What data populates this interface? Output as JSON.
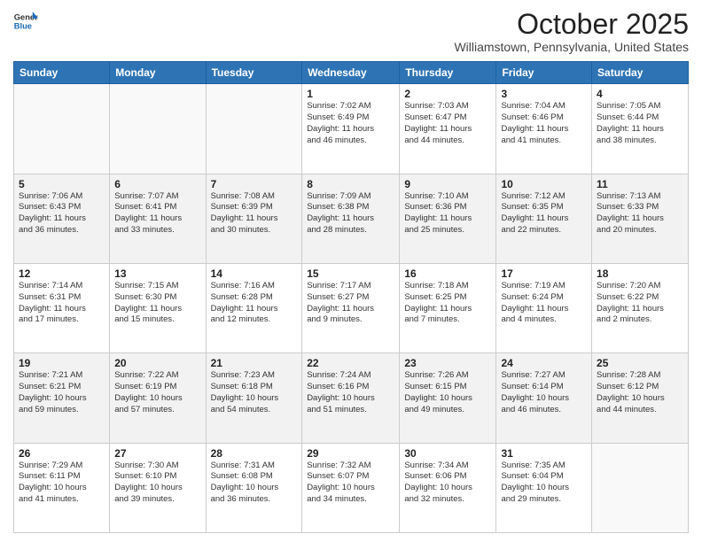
{
  "logo": {
    "general": "General",
    "blue": "Blue"
  },
  "header": {
    "month": "October 2025",
    "location": "Williamstown, Pennsylvania, United States"
  },
  "days_of_week": [
    "Sunday",
    "Monday",
    "Tuesday",
    "Wednesday",
    "Thursday",
    "Friday",
    "Saturday"
  ],
  "weeks": [
    [
      {
        "num": "",
        "info": ""
      },
      {
        "num": "",
        "info": ""
      },
      {
        "num": "",
        "info": ""
      },
      {
        "num": "1",
        "info": "Sunrise: 7:02 AM\nSunset: 6:49 PM\nDaylight: 11 hours\nand 46 minutes."
      },
      {
        "num": "2",
        "info": "Sunrise: 7:03 AM\nSunset: 6:47 PM\nDaylight: 11 hours\nand 44 minutes."
      },
      {
        "num": "3",
        "info": "Sunrise: 7:04 AM\nSunset: 6:46 PM\nDaylight: 11 hours\nand 41 minutes."
      },
      {
        "num": "4",
        "info": "Sunrise: 7:05 AM\nSunset: 6:44 PM\nDaylight: 11 hours\nand 38 minutes."
      }
    ],
    [
      {
        "num": "5",
        "info": "Sunrise: 7:06 AM\nSunset: 6:43 PM\nDaylight: 11 hours\nand 36 minutes."
      },
      {
        "num": "6",
        "info": "Sunrise: 7:07 AM\nSunset: 6:41 PM\nDaylight: 11 hours\nand 33 minutes."
      },
      {
        "num": "7",
        "info": "Sunrise: 7:08 AM\nSunset: 6:39 PM\nDaylight: 11 hours\nand 30 minutes."
      },
      {
        "num": "8",
        "info": "Sunrise: 7:09 AM\nSunset: 6:38 PM\nDaylight: 11 hours\nand 28 minutes."
      },
      {
        "num": "9",
        "info": "Sunrise: 7:10 AM\nSunset: 6:36 PM\nDaylight: 11 hours\nand 25 minutes."
      },
      {
        "num": "10",
        "info": "Sunrise: 7:12 AM\nSunset: 6:35 PM\nDaylight: 11 hours\nand 22 minutes."
      },
      {
        "num": "11",
        "info": "Sunrise: 7:13 AM\nSunset: 6:33 PM\nDaylight: 11 hours\nand 20 minutes."
      }
    ],
    [
      {
        "num": "12",
        "info": "Sunrise: 7:14 AM\nSunset: 6:31 PM\nDaylight: 11 hours\nand 17 minutes."
      },
      {
        "num": "13",
        "info": "Sunrise: 7:15 AM\nSunset: 6:30 PM\nDaylight: 11 hours\nand 15 minutes."
      },
      {
        "num": "14",
        "info": "Sunrise: 7:16 AM\nSunset: 6:28 PM\nDaylight: 11 hours\nand 12 minutes."
      },
      {
        "num": "15",
        "info": "Sunrise: 7:17 AM\nSunset: 6:27 PM\nDaylight: 11 hours\nand 9 minutes."
      },
      {
        "num": "16",
        "info": "Sunrise: 7:18 AM\nSunset: 6:25 PM\nDaylight: 11 hours\nand 7 minutes."
      },
      {
        "num": "17",
        "info": "Sunrise: 7:19 AM\nSunset: 6:24 PM\nDaylight: 11 hours\nand 4 minutes."
      },
      {
        "num": "18",
        "info": "Sunrise: 7:20 AM\nSunset: 6:22 PM\nDaylight: 11 hours\nand 2 minutes."
      }
    ],
    [
      {
        "num": "19",
        "info": "Sunrise: 7:21 AM\nSunset: 6:21 PM\nDaylight: 10 hours\nand 59 minutes."
      },
      {
        "num": "20",
        "info": "Sunrise: 7:22 AM\nSunset: 6:19 PM\nDaylight: 10 hours\nand 57 minutes."
      },
      {
        "num": "21",
        "info": "Sunrise: 7:23 AM\nSunset: 6:18 PM\nDaylight: 10 hours\nand 54 minutes."
      },
      {
        "num": "22",
        "info": "Sunrise: 7:24 AM\nSunset: 6:16 PM\nDaylight: 10 hours\nand 51 minutes."
      },
      {
        "num": "23",
        "info": "Sunrise: 7:26 AM\nSunset: 6:15 PM\nDaylight: 10 hours\nand 49 minutes."
      },
      {
        "num": "24",
        "info": "Sunrise: 7:27 AM\nSunset: 6:14 PM\nDaylight: 10 hours\nand 46 minutes."
      },
      {
        "num": "25",
        "info": "Sunrise: 7:28 AM\nSunset: 6:12 PM\nDaylight: 10 hours\nand 44 minutes."
      }
    ],
    [
      {
        "num": "26",
        "info": "Sunrise: 7:29 AM\nSunset: 6:11 PM\nDaylight: 10 hours\nand 41 minutes."
      },
      {
        "num": "27",
        "info": "Sunrise: 7:30 AM\nSunset: 6:10 PM\nDaylight: 10 hours\nand 39 minutes."
      },
      {
        "num": "28",
        "info": "Sunrise: 7:31 AM\nSunset: 6:08 PM\nDaylight: 10 hours\nand 36 minutes."
      },
      {
        "num": "29",
        "info": "Sunrise: 7:32 AM\nSunset: 6:07 PM\nDaylight: 10 hours\nand 34 minutes."
      },
      {
        "num": "30",
        "info": "Sunrise: 7:34 AM\nSunset: 6:06 PM\nDaylight: 10 hours\nand 32 minutes."
      },
      {
        "num": "31",
        "info": "Sunrise: 7:35 AM\nSunset: 6:04 PM\nDaylight: 10 hours\nand 29 minutes."
      },
      {
        "num": "",
        "info": ""
      }
    ]
  ]
}
